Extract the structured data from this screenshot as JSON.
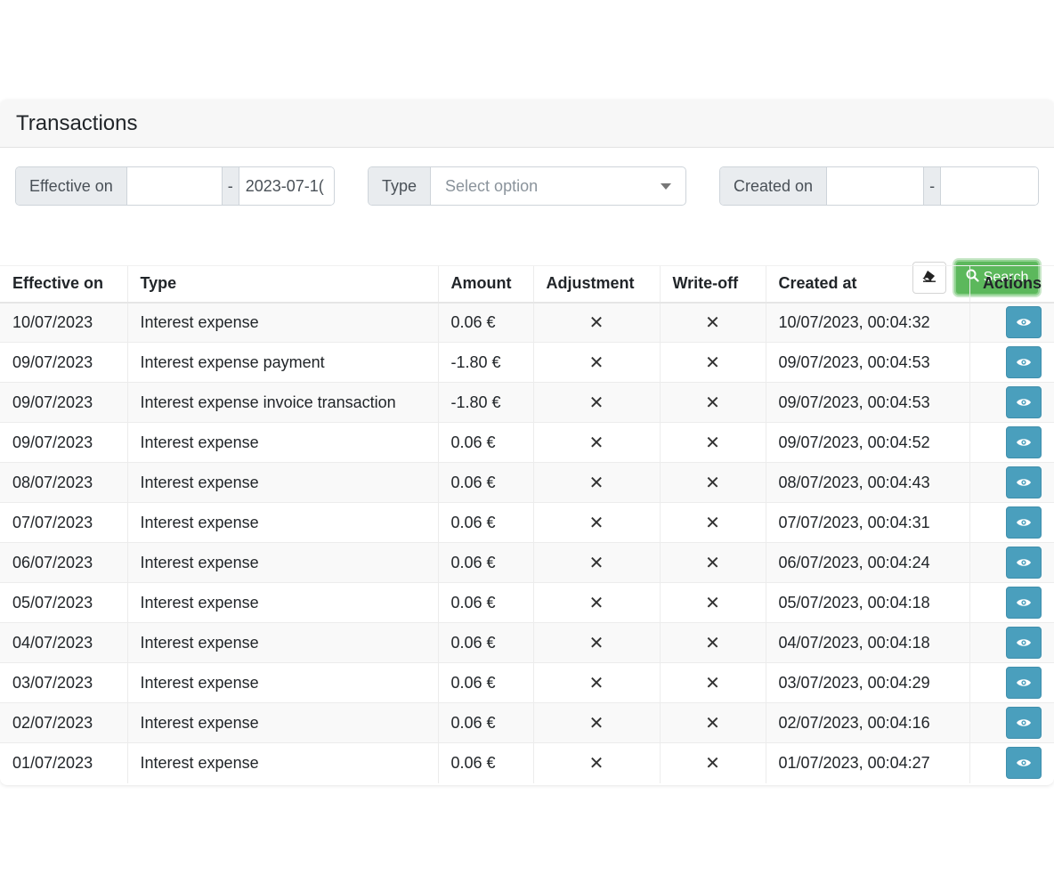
{
  "title": "Transactions",
  "filters": {
    "effective_on": {
      "label": "Effective on",
      "from_value": "",
      "separator": "-",
      "to_value": "2023-07-1("
    },
    "type": {
      "label": "Type",
      "placeholder": "Select option"
    },
    "created_on": {
      "label": "Created on",
      "from_value": "",
      "separator": "-",
      "to_value": ""
    },
    "search_label": "Search",
    "clear_icon": "eraser-icon",
    "search_icon": "search-icon"
  },
  "colors": {
    "search_button": "#5cb85c",
    "view_button": "#4a9fbd",
    "header_bg": "#f7f7f7"
  },
  "table": {
    "columns": [
      "Effective on",
      "Type",
      "Amount",
      "Adjustment",
      "Write-off",
      "Created at",
      "Actions"
    ],
    "mark": "✕",
    "rows": [
      {
        "effective_on": "10/07/2023",
        "type": "Interest expense",
        "amount": "0.06 €",
        "adjustment": "✕",
        "write_off": "✕",
        "created_at": "10/07/2023, 00:04:32"
      },
      {
        "effective_on": "09/07/2023",
        "type": "Interest expense payment",
        "amount": "-1.80 €",
        "adjustment": "✕",
        "write_off": "✕",
        "created_at": "09/07/2023, 00:04:53"
      },
      {
        "effective_on": "09/07/2023",
        "type": "Interest expense invoice transaction",
        "amount": "-1.80 €",
        "adjustment": "✕",
        "write_off": "✕",
        "created_at": "09/07/2023, 00:04:53"
      },
      {
        "effective_on": "09/07/2023",
        "type": "Interest expense",
        "amount": "0.06 €",
        "adjustment": "✕",
        "write_off": "✕",
        "created_at": "09/07/2023, 00:04:52"
      },
      {
        "effective_on": "08/07/2023",
        "type": "Interest expense",
        "amount": "0.06 €",
        "adjustment": "✕",
        "write_off": "✕",
        "created_at": "08/07/2023, 00:04:43"
      },
      {
        "effective_on": "07/07/2023",
        "type": "Interest expense",
        "amount": "0.06 €",
        "adjustment": "✕",
        "write_off": "✕",
        "created_at": "07/07/2023, 00:04:31"
      },
      {
        "effective_on": "06/07/2023",
        "type": "Interest expense",
        "amount": "0.06 €",
        "adjustment": "✕",
        "write_off": "✕",
        "created_at": "06/07/2023, 00:04:24"
      },
      {
        "effective_on": "05/07/2023",
        "type": "Interest expense",
        "amount": "0.06 €",
        "adjustment": "✕",
        "write_off": "✕",
        "created_at": "05/07/2023, 00:04:18"
      },
      {
        "effective_on": "04/07/2023",
        "type": "Interest expense",
        "amount": "0.06 €",
        "adjustment": "✕",
        "write_off": "✕",
        "created_at": "04/07/2023, 00:04:18"
      },
      {
        "effective_on": "03/07/2023",
        "type": "Interest expense",
        "amount": "0.06 €",
        "adjustment": "✕",
        "write_off": "✕",
        "created_at": "03/07/2023, 00:04:29"
      },
      {
        "effective_on": "02/07/2023",
        "type": "Interest expense",
        "amount": "0.06 €",
        "adjustment": "✕",
        "write_off": "✕",
        "created_at": "02/07/2023, 00:04:16"
      },
      {
        "effective_on": "01/07/2023",
        "type": "Interest expense",
        "amount": "0.06 €",
        "adjustment": "✕",
        "write_off": "✕",
        "created_at": "01/07/2023, 00:04:27"
      }
    ],
    "row_action_icon": "eye-icon"
  }
}
